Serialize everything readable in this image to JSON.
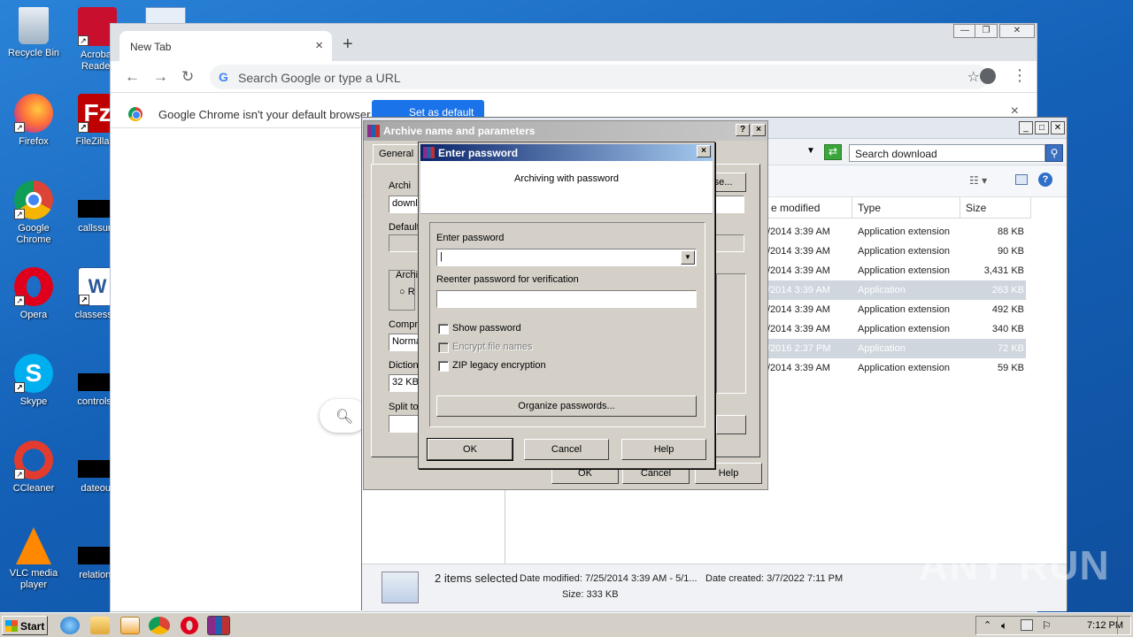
{
  "desktop": {
    "icons": [
      {
        "label": "Recycle Bin"
      },
      {
        "label": "Acrobat Reader"
      },
      {
        "label": "Firefox"
      },
      {
        "label": "FileZilla C"
      },
      {
        "label": "Google Chrome"
      },
      {
        "label": "callssure"
      },
      {
        "label": "Opera"
      },
      {
        "label": "classesshi"
      },
      {
        "label": "Skype"
      },
      {
        "label": "controlstr"
      },
      {
        "label": "CCleaner"
      },
      {
        "label": "dateour"
      },
      {
        "label": "VLC media player"
      },
      {
        "label": "relations"
      }
    ]
  },
  "chrome": {
    "tab_title": "New Tab",
    "tab_close": "×",
    "new_tab": "+",
    "omnibox_placeholder": "Search Google or type a URL",
    "infobar_message": "Google Chrome isn't your default browser",
    "set_default_label": "Set as default",
    "infobar_close": "×"
  },
  "explorer": {
    "search_placeholder": "Search download",
    "columns": [
      "e modified",
      "Type",
      "Size"
    ],
    "rows": [
      {
        "date": "/2014 3:39 AM",
        "type": "Application extension",
        "size": "88 KB",
        "selected": false
      },
      {
        "date": "/2014 3:39 AM",
        "type": "Application extension",
        "size": "90 KB",
        "selected": false
      },
      {
        "date": "/2014 3:39 AM",
        "type": "Application extension",
        "size": "3,431 KB",
        "selected": false
      },
      {
        "date": "/2014 3:39 AM",
        "type": "Application",
        "size": "263 KB",
        "selected": true
      },
      {
        "date": "/2014 3:39 AM",
        "type": "Application extension",
        "size": "492 KB",
        "selected": false
      },
      {
        "date": "/2014 3:39 AM",
        "type": "Application extension",
        "size": "340 KB",
        "selected": false
      },
      {
        "date": "/2016 2:37 PM",
        "type": "Application",
        "size": "72 KB",
        "selected": true
      },
      {
        "date": "/2014 3:39 AM",
        "type": "Application extension",
        "size": "59 KB",
        "selected": false
      }
    ],
    "status": {
      "selection": "2 items selected",
      "modified": "Date modified: 7/25/2014 3:39 AM - 5/1...",
      "created": "Date created: 3/7/2022 7:11 PM",
      "size": "Size: 333 KB"
    }
  },
  "archive_dialog": {
    "title": "Archive name and parameters",
    "help_btn": "?",
    "close_btn": "×",
    "tab_general": "General",
    "archive_label": "Archi",
    "archive_value": "downl",
    "browse_label": "se...",
    "default_label": "Default",
    "archive_format_label": "Archi",
    "radio_label": "R",
    "compression_label": "Compre",
    "compression_value": "Norma",
    "dictionary_label": "Diction",
    "dictionary_value": "32 KB",
    "split_label": "Split to",
    "ok": "OK",
    "cancel": "Cancel",
    "help": "Help"
  },
  "password_dialog": {
    "title": "Enter password",
    "close_btn": "×",
    "banner_text": "Archiving with password",
    "enter_password_label": "Enter password",
    "enter_password_value": "|",
    "reenter_label": "Reenter password for verification",
    "reenter_value": "",
    "show_password": "Show password",
    "encrypt_names": "Encrypt file names",
    "zip_legacy": "ZIP legacy encryption",
    "organize": "Organize passwords...",
    "ok": "OK",
    "cancel": "Cancel",
    "help": "Help"
  },
  "taskbar": {
    "start": "Start",
    "clock": "7:12 PM"
  },
  "watermark": "ANY RUN"
}
